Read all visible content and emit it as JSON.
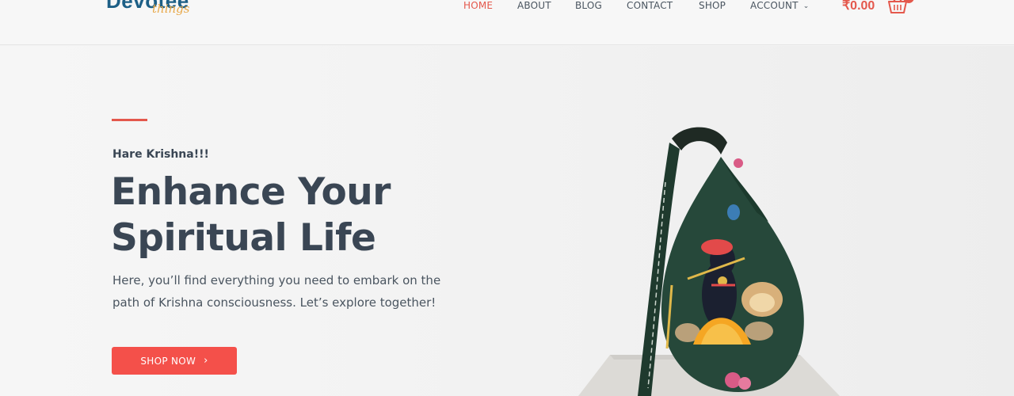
{
  "header": {
    "logo": {
      "main": "Devotee",
      "sub": "things"
    },
    "nav": [
      {
        "label": "HOME",
        "active": true
      },
      {
        "label": "ABOUT",
        "active": false
      },
      {
        "label": "BLOG",
        "active": false
      },
      {
        "label": "CONTACT",
        "active": false
      },
      {
        "label": "SHOP",
        "active": false
      },
      {
        "label": "ACCOUNT",
        "active": false,
        "dropdown": true
      }
    ],
    "cart": {
      "total": "₹0.00",
      "icon": "basket-icon"
    }
  },
  "hero": {
    "eyebrow": "Hare Krishna!!!",
    "headline_line1": "Enhance Your",
    "headline_line2": "Spiritual Life",
    "lead": "Here, you’ll find everything you need to embark on the path of Krishna consciousness. Let’s explore together!",
    "cta_label": "SHOP NOW",
    "cta_icon": "chevron-right-icon",
    "image": "krishna-japa-bag-image"
  },
  "colors": {
    "accent": "#e4584c",
    "button": "#f4504a",
    "heading": "#3a4654",
    "logo_blue": "#1d5f86",
    "logo_gold": "#e8a94a"
  }
}
